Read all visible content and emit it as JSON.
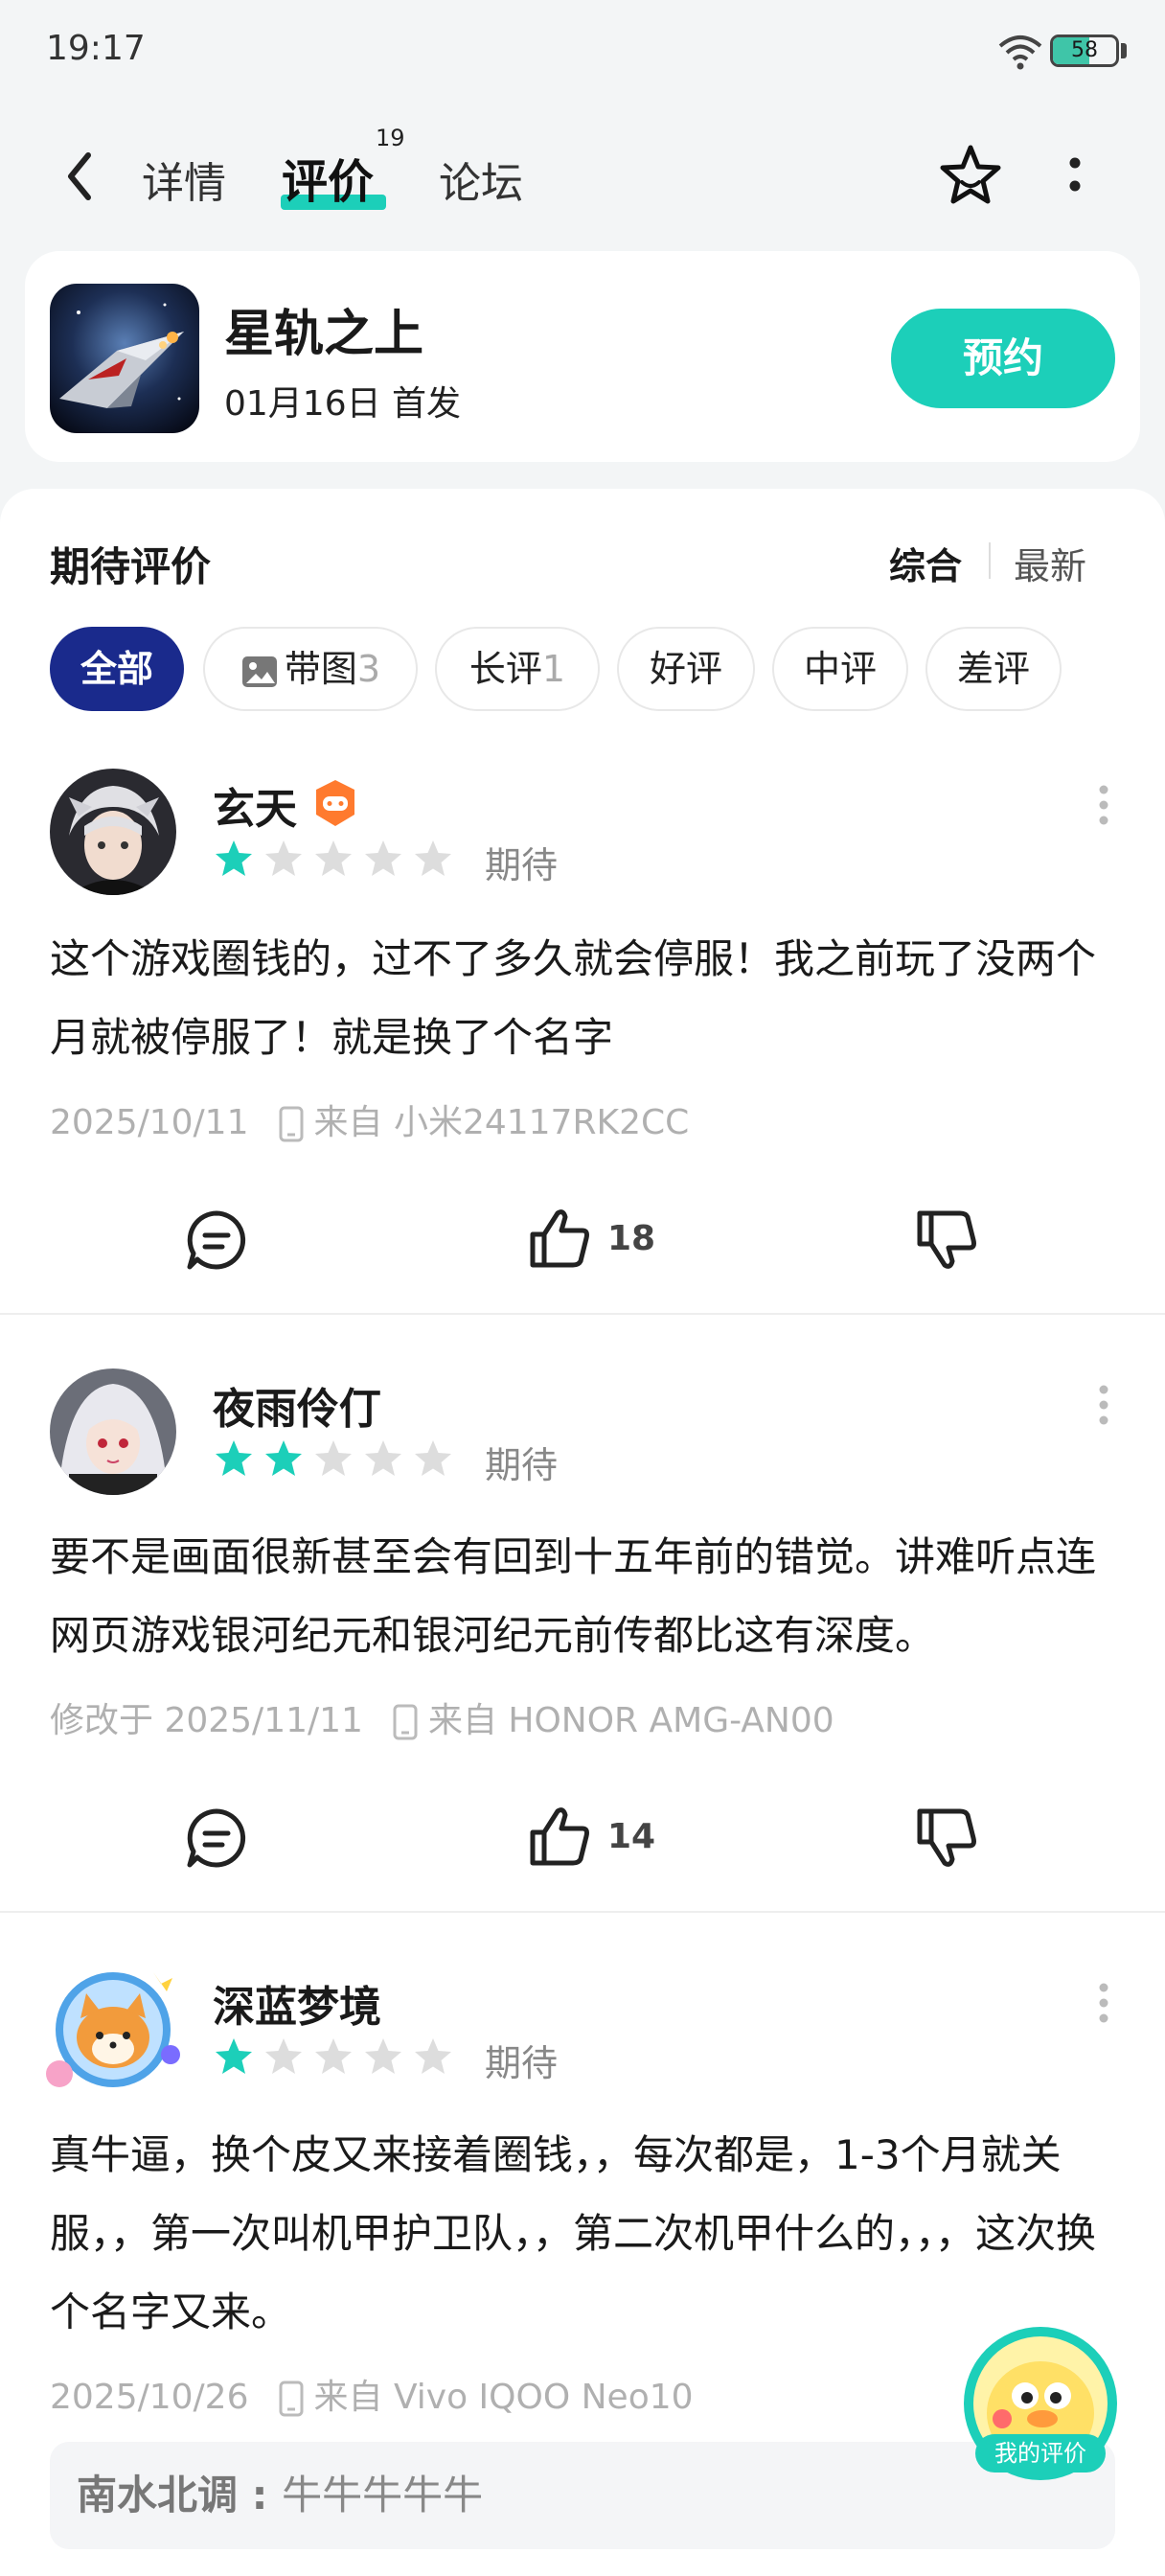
{
  "status": {
    "time": "19:17",
    "battery": "58",
    "battery_level": 0.58
  },
  "nav": {
    "tabs": [
      {
        "label": "详情"
      },
      {
        "label": "评价",
        "badge": "19"
      },
      {
        "label": "论坛"
      }
    ]
  },
  "game": {
    "title": "星轨之上",
    "release": "01月16日 首发",
    "reserve_label": "预约"
  },
  "reviews_section": {
    "title": "期待评价",
    "sort_comprehensive": "综合",
    "sort_latest": "最新",
    "filters": [
      {
        "label": "全部",
        "count": ""
      },
      {
        "label": "带图",
        "count": "3"
      },
      {
        "label": "长评",
        "count": "1"
      },
      {
        "label": "好评",
        "count": ""
      },
      {
        "label": "中评",
        "count": ""
      },
      {
        "label": "差评",
        "count": ""
      }
    ]
  },
  "reviews": [
    {
      "user": "玄天",
      "rating": 1,
      "rating_label": "期待",
      "text": "这个游戏圈钱的，过不了多久就会停服！我之前玩了没两个月就被停服了！就是换了个名字",
      "date": "2025/10/11",
      "device": "来自 小米24117RK2CC",
      "likes": "18"
    },
    {
      "user": "夜雨伶仃",
      "rating": 2,
      "rating_label": "期待",
      "text": "要不是画面很新甚至会有回到十五年前的错觉。讲难听点连网页游戏银河纪元和银河纪元前传都比这有深度。",
      "date": "修改于 2025/11/11",
      "device": "来自 HONOR AMG-AN00",
      "likes": "14"
    },
    {
      "user": "深蓝梦境",
      "rating": 1,
      "rating_label": "期待",
      "text": "真牛逼，换个皮又来接着圈钱，，每次都是，1-3个月就关服，，第一次叫机甲护卫队，，第二次机甲什么的，，，这次换个名字又来。",
      "date": "2025/10/26",
      "device": "来自 Vivo IQOO Neo10",
      "reply": {
        "name": "南水北调",
        "separator": " : ",
        "text": "牛牛牛牛牛"
      }
    }
  ],
  "fab": {
    "label": "我的评价"
  },
  "colors": {
    "accent": "#1ccfb9",
    "active_chip": "#1a2a8c",
    "star_on": "#1ccfb9",
    "star_off": "#dddddd"
  }
}
